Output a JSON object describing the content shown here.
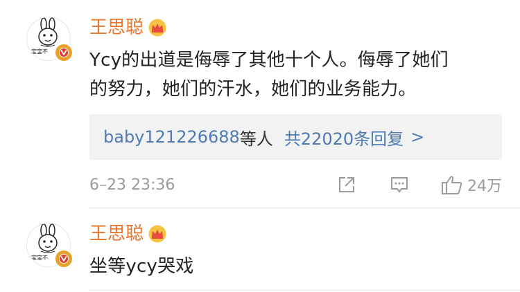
{
  "comments": [
    {
      "username": "王思聪",
      "avatar_caption": "宝宝不",
      "text_line1": "Ycy的出道是侮辱了其他十个人。侮辱了她们",
      "text_line2": "的努力，她们的汗水，她们的业务能力。",
      "replies": {
        "users": "baby121226688",
        "users_suffix": "等人",
        "count_text": "共22020条回复",
        "arrow": ">"
      },
      "timestamp": "6–23 23:36",
      "like_count": "24万"
    },
    {
      "username": "王思聪",
      "avatar_caption": "宝宝不",
      "text_line1": "坐等ycy哭戏"
    }
  ],
  "icons": {
    "share": "share-icon",
    "comment": "comment-icon",
    "like": "thumbs-up-icon",
    "crown": "crown-icon",
    "verified": "verified-v-icon"
  },
  "colors": {
    "username": "#e8762d",
    "link": "#4e7bb4",
    "meta": "#9a9a9a",
    "reply_bg": "#f2f2f2"
  }
}
